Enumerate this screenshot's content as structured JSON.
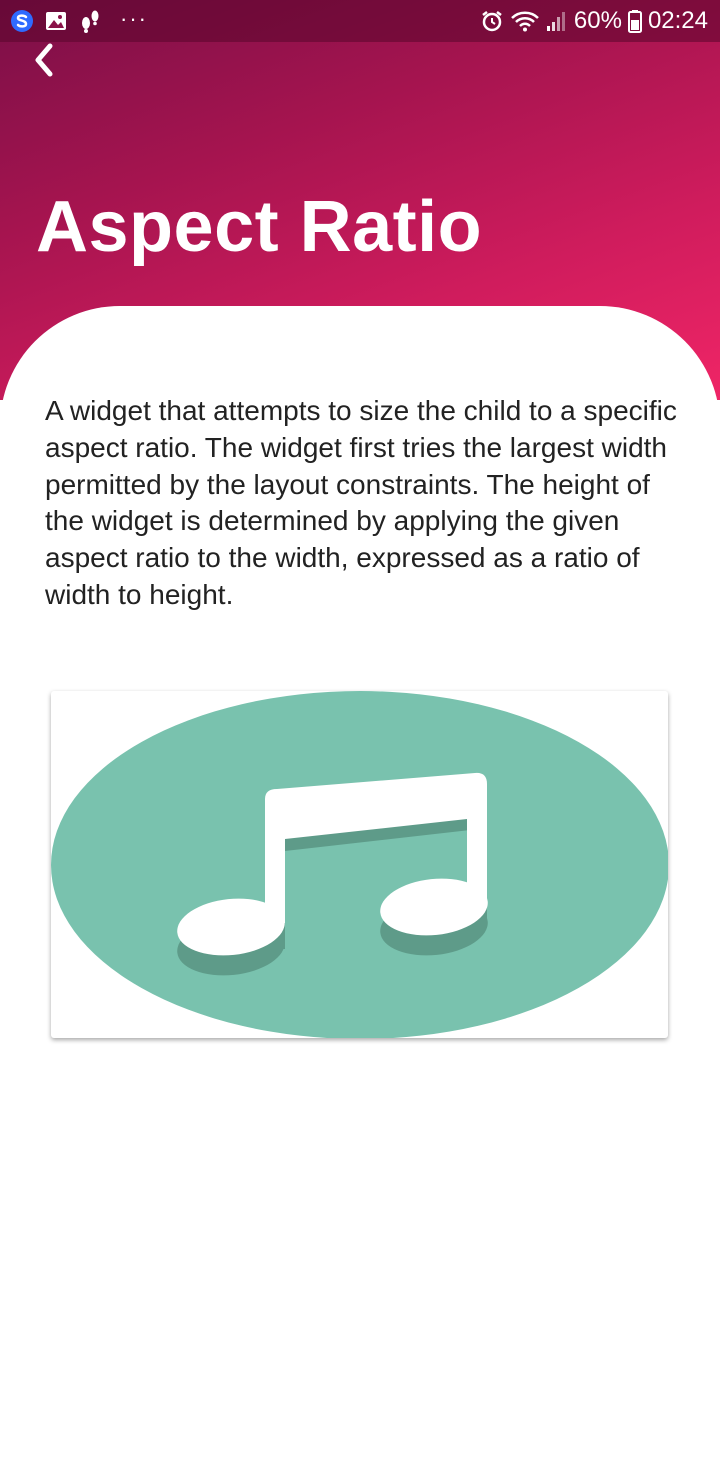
{
  "status_bar": {
    "battery_percent": "60%",
    "time": "02:24",
    "overflow_dots": "···",
    "icons": [
      "samsung-s-icon",
      "gallery-icon",
      "footprint-icon",
      "alarm-icon",
      "wifi-icon",
      "signal-icon",
      "battery-icon"
    ]
  },
  "header": {
    "back_icon": "chevron-left-icon",
    "title": "Aspect Ratio",
    "gradient_colors": [
      "#7a0f47",
      "#ef2566"
    ]
  },
  "content": {
    "description": "A widget that attempts to size the child to a specific aspect ratio. The widget first tries the largest width permitted by the layout constraints. The height of the widget is determined by applying the given aspect ratio to the width, expressed as a ratio of width to height."
  },
  "image_card": {
    "icon": "music-note-icon",
    "ellipse_color": "#79c2ae",
    "note_color": "#ffffff",
    "shadow_color": "#5e9b89"
  }
}
